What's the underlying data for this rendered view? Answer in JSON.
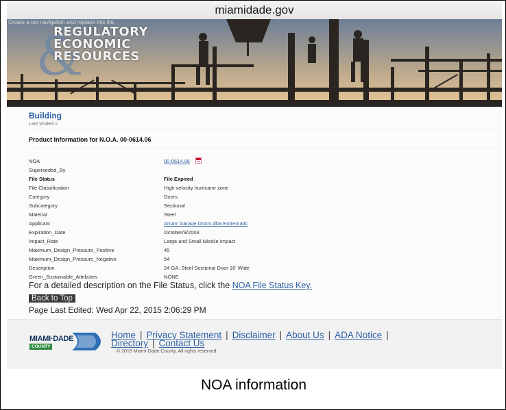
{
  "browser": {
    "url": "miamidade.gov"
  },
  "banner": {
    "hint": "Create a top navigation and replace this file.",
    "brand_lines": [
      "REGULATORY",
      "ECONOMIC",
      "RESOURCES"
    ]
  },
  "page": {
    "section": "Building",
    "breadcrumb": "Last Visited »",
    "title": "Product Information for N.O.A. 00-0614.06"
  },
  "details": [
    {
      "label": "NOA",
      "value": "00-0614.06",
      "is_link": true,
      "has_pdf": true
    },
    {
      "label": "Superseded_By",
      "value": ""
    },
    {
      "label": "File Status",
      "value": "File Expired",
      "bold": true
    },
    {
      "label": "File Classification",
      "value": "High velocity hurricane zone"
    },
    {
      "label": "Category",
      "value": "Doors"
    },
    {
      "label": "Subcategory",
      "value": "Sectional"
    },
    {
      "label": "Material",
      "value": "Steel"
    },
    {
      "label": "Applicant",
      "value": "Amarr Garage Doors dba Entrematic",
      "is_link": true
    },
    {
      "label": "Expiration_Date",
      "value": "October/9/2003"
    },
    {
      "label": "Impact_Rate",
      "value": "Large and Small Missile Impact"
    },
    {
      "label": "Maximum_Design_Pressure_Positive",
      "value": "45"
    },
    {
      "label": "Maximum_Design_Pressure_Negative",
      "value": "54"
    },
    {
      "label": "Description",
      "value": "24 GA. Steel Sectional Door 16' Wide"
    },
    {
      "label": "Green_Sustainable_Attributes",
      "value": "NONE"
    }
  ],
  "status_note": {
    "text": "For a detailed description on the File Status, click the ",
    "link": "NOA File Status Key."
  },
  "back_to_top": "Back to Top",
  "last_edited": "Page Last Edited: Wed Apr 22, 2015 2:06:29 PM",
  "footer": {
    "logo_text": "MIAMI·DADE",
    "logo_badge": "COUNTY",
    "links_line1": [
      "Home",
      "Privacy Statement",
      "Disclaimer",
      "About Us",
      "ADA Notice"
    ],
    "links_line2": [
      "Directory",
      "Contact Us"
    ],
    "separator": "|",
    "copyright": "© 2016 Miami-Dade County. All rights reserved."
  },
  "caption": "NOA information",
  "colors": {
    "link": "#2b5ea3",
    "section": "#2b5ea3",
    "county_green": "#2e8b3d",
    "logo_navy": "#11335f"
  }
}
